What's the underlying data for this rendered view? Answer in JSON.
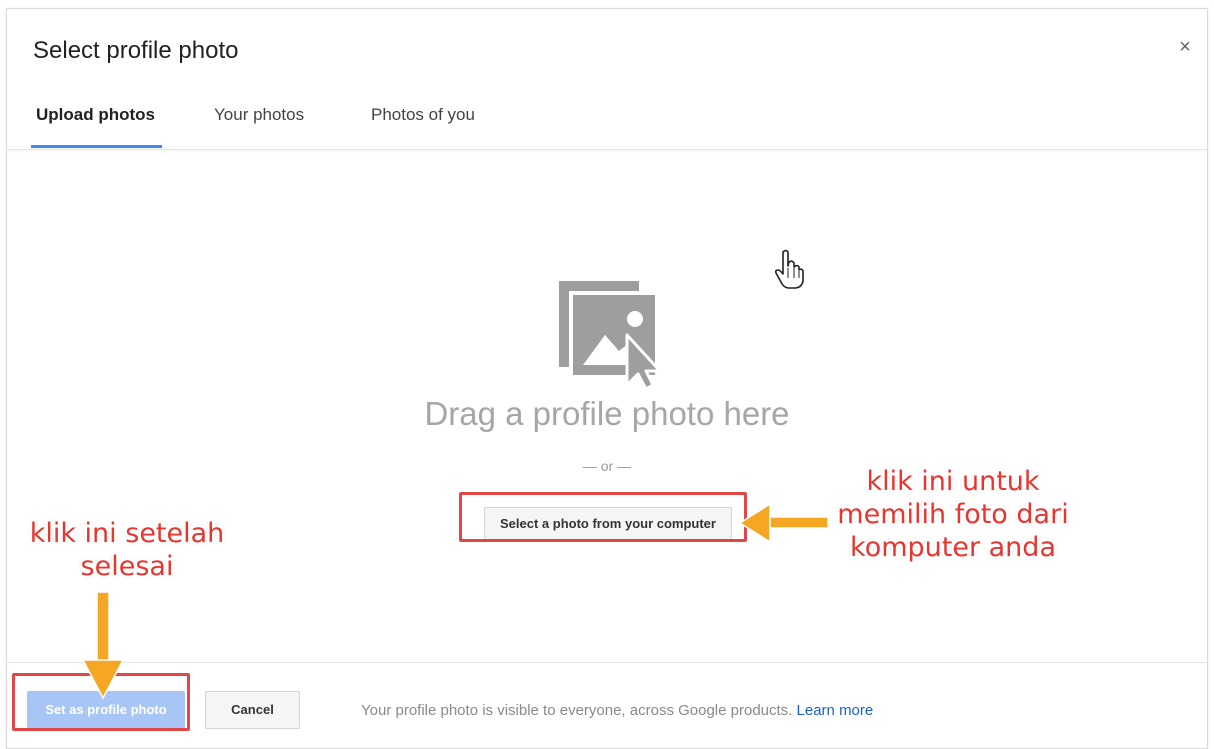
{
  "dialog": {
    "title": "Select profile photo",
    "close_label": "×"
  },
  "tabs": [
    {
      "label": "Upload photos",
      "active": true
    },
    {
      "label": "Your photos",
      "active": false
    },
    {
      "label": "Photos of you",
      "active": false
    }
  ],
  "upload": {
    "drag_text": "Drag a profile photo here",
    "or_text": "— or —",
    "select_button": "Select a photo from your computer"
  },
  "footer": {
    "set_button": "Set as profile photo",
    "cancel_button": "Cancel",
    "note": "Your profile photo is visible to everyone, across Google products.",
    "learn_more": "Learn more"
  },
  "annotations": {
    "right_text": "klik ini untuk memilih foto dari komputer anda",
    "left_text": "klik ini setelah selesai",
    "highlight_color": "#e04848",
    "arrow_color": "#f5a623"
  },
  "colors": {
    "accent": "#4285f4",
    "primary_disabled": "#a7c5f5",
    "link": "#1a5fd1"
  },
  "icons": {
    "upload": "photo-upload-icon",
    "cursor": "hand-cursor-icon",
    "close": "close-icon"
  }
}
